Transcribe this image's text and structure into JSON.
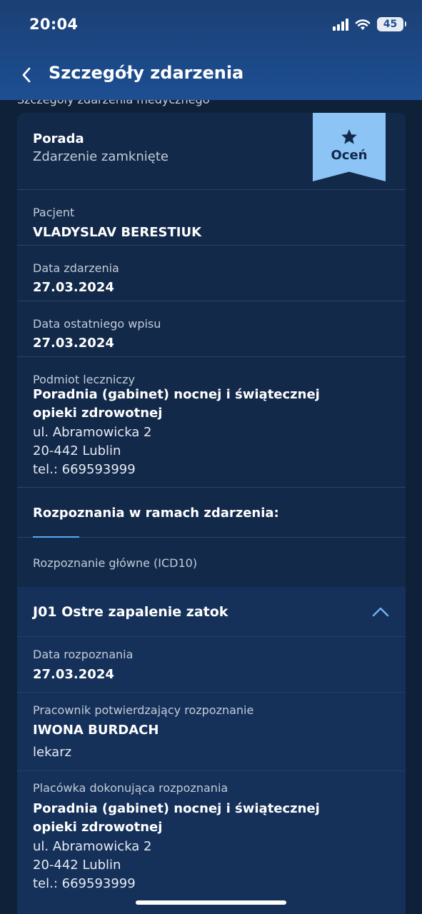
{
  "status_bar": {
    "time": "20:04",
    "battery": "45"
  },
  "header": {
    "title": "Szczegóły zdarzenia"
  },
  "peek_text": "Szczegóły zdarzenia medycznego",
  "event": {
    "type": "Porada",
    "status": "Zdarzenie zamknięte",
    "rate_label": "Oceń",
    "patient_label": "Pacjent",
    "patient_name": "VLADYSLAV BERESTIUK",
    "date_label": "Data zdarzenia",
    "date": "27.03.2024",
    "last_entry_label": "Data ostatniego wpisu",
    "last_entry_date": "27.03.2024",
    "provider_label": "Podmiot leczniczy",
    "provider_name_1": "Poradnia (gabinet) nocnej i świątecznej",
    "provider_name_2": "opieki zdrowotnej",
    "provider_street": "ul. Abramowicka 2",
    "provider_city": "20-442 Lublin",
    "provider_phone": "tel.: 669593999"
  },
  "diagnoses": {
    "heading": "Rozpoznania w ramach zdarzenia:",
    "main_label": "Rozpoznanie główne (ICD10)",
    "item": {
      "title": "J01 Ostre zapalenie zatok",
      "date_label": "Data rozpoznania",
      "date": "27.03.2024",
      "worker_label": "Pracownik potwierdzający rozpoznanie",
      "worker_name": "IWONA BURDACH",
      "worker_role": "lekarz",
      "facility_label": "Placówka dokonująca rozpoznania",
      "facility_name_1": "Poradnia (gabinet) nocnej i świątecznej",
      "facility_name_2": "opieki zdrowotnej",
      "facility_street": "ul. Abramowicka 2",
      "facility_city": "20-442 Lublin",
      "facility_phone": "tel.: 669593999"
    }
  },
  "colors": {
    "background": "#0f2138",
    "card": "#13294a",
    "header": "#1d4f93",
    "accent": "#8cc4f5"
  },
  "icons": [
    "signal-icon",
    "wifi-icon",
    "battery-icon",
    "back-icon",
    "star-icon",
    "chevron-up-icon"
  ]
}
